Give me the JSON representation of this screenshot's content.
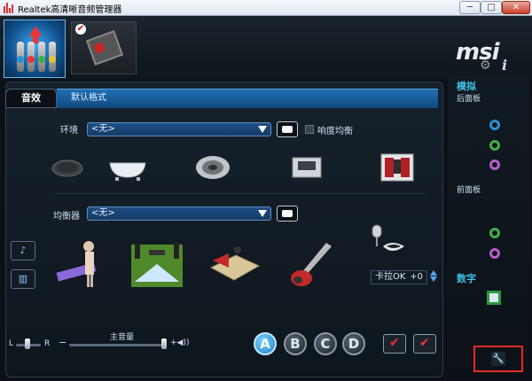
{
  "window": {
    "title": "Realtek高清晰音频管理器",
    "min_label": "─",
    "max_label": "□",
    "close_label": "✕"
  },
  "brand": {
    "logo": "msi"
  },
  "icons": {
    "gear": "⚙",
    "info": "i",
    "wrench": "🔧"
  },
  "tabs": {
    "effects": "音效",
    "default_format": "默认格式"
  },
  "environment": {
    "label": "环境",
    "value": "<无>",
    "loudness_label": "响度均衡"
  },
  "equalizer": {
    "label": "均衡器",
    "value": "<无>"
  },
  "karaoke": {
    "label": "卡拉OK",
    "value": "+0"
  },
  "volume": {
    "title": "主音量",
    "left": "L",
    "right": "R",
    "minus": "−",
    "plus": "+◀))"
  },
  "profiles": [
    "A",
    "B",
    "C",
    "D"
  ],
  "right_panel": {
    "analog": "模拟",
    "rear_panel": "后面板",
    "front_panel": "前面板",
    "digital": "数字"
  },
  "jack_colors": {
    "rear": [
      "#2a8fd6",
      "#3fae48",
      "#b35ec9"
    ],
    "front": [
      "#3fae48",
      "#b35ec9"
    ]
  }
}
